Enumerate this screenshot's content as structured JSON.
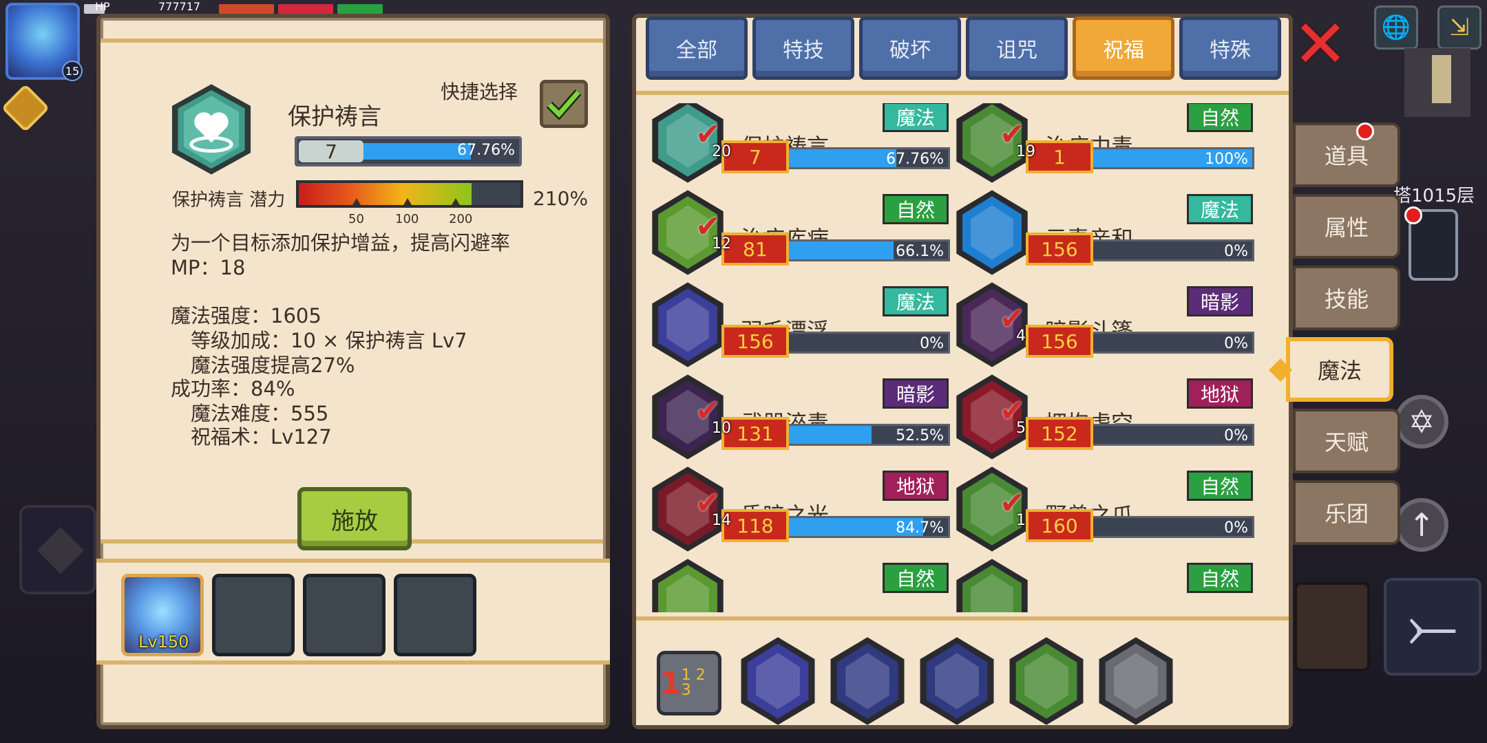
{
  "hud": {
    "hp_label": "HP",
    "hp_value": "777717",
    "level_badge": "15",
    "floor": "塔1015层"
  },
  "detail": {
    "skill_name": "保护祷言",
    "quick_select_label": "快捷选择",
    "level": "7",
    "progress_pct_text": "67.76%",
    "progress": 0.6776,
    "potential_label": "保护祷言 潜力",
    "potential_value": "210%",
    "potential_ticks": [
      "50",
      "100",
      "200"
    ],
    "desc": [
      "为一个目标添加保护增益，提高闪避率",
      "MP：18",
      "",
      "魔法强度：1605",
      "　等级加成：10 × 保护祷言 Lv7",
      "　魔法强度提高27%",
      "成功率：84%",
      "　魔法难度：555",
      "　祝福术：Lv127"
    ],
    "cast_button": "施放"
  },
  "party": {
    "hero_level": "Lv150"
  },
  "tabs": [
    {
      "label": "全部",
      "active": false
    },
    {
      "label": "特技",
      "active": false
    },
    {
      "label": "破坏",
      "active": false
    },
    {
      "label": "诅咒",
      "active": false
    },
    {
      "label": "祝福",
      "active": true
    },
    {
      "label": "特殊",
      "active": false
    }
  ],
  "skills": [
    {
      "name": "保护祷言",
      "category": "魔法",
      "cat_color": "#34b89e",
      "level": "7",
      "pct_text": "67.76%",
      "progress": 0.6776,
      "count": "20",
      "checked": true,
      "hex_color": "#3f9c8a",
      "icon": "heart-icon"
    },
    {
      "name": "治疗中毒",
      "category": "自然",
      "cat_color": "#2aa040",
      "level": "1",
      "pct_text": "100%",
      "progress": 1.0,
      "count": "19",
      "checked": true,
      "hex_color": "#4a8a34",
      "icon": "skull-icon"
    },
    {
      "name": "治疗疾病",
      "category": "自然",
      "cat_color": "#2aa040",
      "level": "81",
      "pct_text": "66.1%",
      "progress": 0.661,
      "count": "12",
      "checked": true,
      "hex_color": "#5a9a30",
      "icon": "syringe-icon"
    },
    {
      "name": "元素亲和",
      "category": "魔法",
      "cat_color": "#34b89e",
      "level": "156",
      "pct_text": "0%",
      "progress": 0,
      "count": "",
      "checked": false,
      "hex_color": "#1e7ed0",
      "icon": "droplets-icon"
    },
    {
      "name": "羽毛漂浮",
      "category": "魔法",
      "cat_color": "#34b89e",
      "level": "156",
      "pct_text": "0%",
      "progress": 0,
      "count": "",
      "checked": false,
      "hex_color": "#3b3e9a",
      "icon": "feather-icon"
    },
    {
      "name": "暗影斗篷",
      "category": "暗影",
      "cat_color": "#5c2c7a",
      "level": "156",
      "pct_text": "0%",
      "progress": 0,
      "count": "4",
      "checked": true,
      "hex_color": "#4a2858",
      "icon": "cloak-icon"
    },
    {
      "name": "武器淬毒",
      "category": "暗影",
      "cat_color": "#5c2c7a",
      "level": "131",
      "pct_text": "52.5%",
      "progress": 0.525,
      "count": "10",
      "checked": true,
      "hex_color": "#3c2450",
      "icon": "dagger-icon"
    },
    {
      "name": "拥抱虚空",
      "category": "地狱",
      "cat_color": "#a0205a",
      "level": "152",
      "pct_text": "0%",
      "progress": 0,
      "count": "5",
      "checked": true,
      "hex_color": "#8a1a2a",
      "icon": "vortex-icon"
    },
    {
      "name": "昏暗之光",
      "category": "地狱",
      "cat_color": "#a0205a",
      "level": "118",
      "pct_text": "84.7%",
      "progress": 0.847,
      "count": "14",
      "checked": true,
      "hex_color": "#7a1a28",
      "icon": "swirl-icon"
    },
    {
      "name": "野兽之爪",
      "category": "自然",
      "cat_color": "#2aa040",
      "level": "160",
      "pct_text": "0%",
      "progress": 0,
      "count": "1",
      "checked": true,
      "hex_color": "#4a8a34",
      "icon": "paw-icon"
    },
    {
      "name": "",
      "category": "自然",
      "cat_color": "#2aa040",
      "level": "",
      "pct_text": "",
      "progress": 0,
      "count": "",
      "checked": false,
      "hex_color": "#5a9a30",
      "icon": "partial-icon"
    },
    {
      "name": "",
      "category": "自然",
      "cat_color": "#2aa040",
      "level": "",
      "pct_text": "",
      "progress": 0,
      "count": "",
      "checked": false,
      "hex_color": "#4a8a34",
      "icon": "partial-icon"
    }
  ],
  "quick_slots": [
    {
      "icon": "eye-icon",
      "color": "#3b3e9a"
    },
    {
      "icon": "boot-icon",
      "color": "#2f3a80"
    },
    {
      "icon": "runner-icon",
      "color": "#2f3a80"
    },
    {
      "icon": "poison-drop-icon",
      "color": "#4a8a34"
    },
    {
      "icon": "arrow-icon",
      "color": "#6a6a72"
    }
  ],
  "slot_switch": "1 2 3",
  "side_tabs": [
    {
      "label": "道具",
      "active": false
    },
    {
      "label": "属性",
      "active": false
    },
    {
      "label": "技能",
      "active": false
    },
    {
      "label": "魔法",
      "active": true
    },
    {
      "label": "天赋",
      "active": false
    },
    {
      "label": "乐团",
      "active": false
    }
  ]
}
